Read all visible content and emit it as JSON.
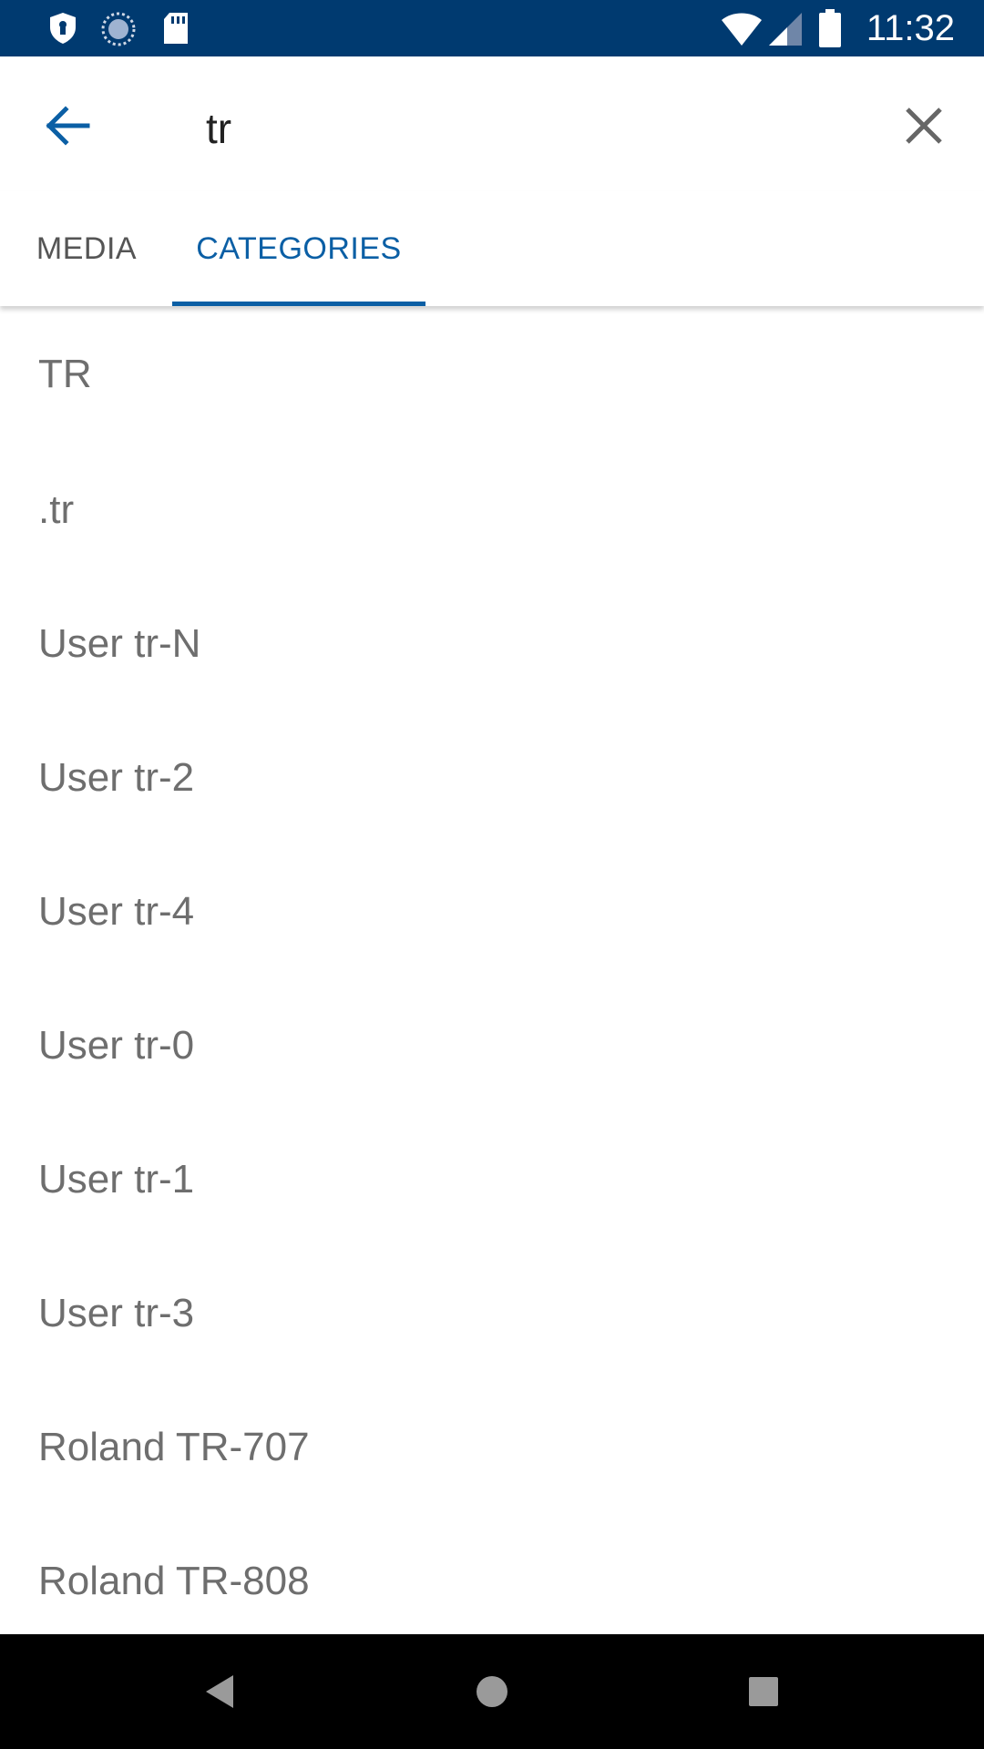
{
  "status_bar": {
    "time": "11:32",
    "icons": [
      "shield-icon",
      "sync-icon",
      "sd-card-icon",
      "wifi-icon",
      "cell-signal-icon",
      "battery-icon"
    ]
  },
  "search": {
    "query": "tr",
    "back_icon": "arrow-back-icon",
    "clear_icon": "close-icon",
    "accent_color": "#0b5fa5"
  },
  "tabs": [
    {
      "label": "MEDIA",
      "selected": false
    },
    {
      "label": "CATEGORIES",
      "selected": true
    }
  ],
  "results": [
    {
      "label": "TR"
    },
    {
      "label": ".tr"
    },
    {
      "label": "User tr-N"
    },
    {
      "label": "User tr-2"
    },
    {
      "label": "User tr-4"
    },
    {
      "label": "User tr-0"
    },
    {
      "label": "User tr-1"
    },
    {
      "label": "User tr-3"
    },
    {
      "label": "Roland TR-707"
    },
    {
      "label": "Roland TR-808"
    }
  ],
  "nav_bar": {
    "buttons": [
      "back-triangle-icon",
      "home-circle-icon",
      "recents-square-icon"
    ]
  },
  "colors": {
    "status_bar": "#003a70",
    "accent": "#0b5fa5",
    "result_text": "#6e6e6e"
  }
}
